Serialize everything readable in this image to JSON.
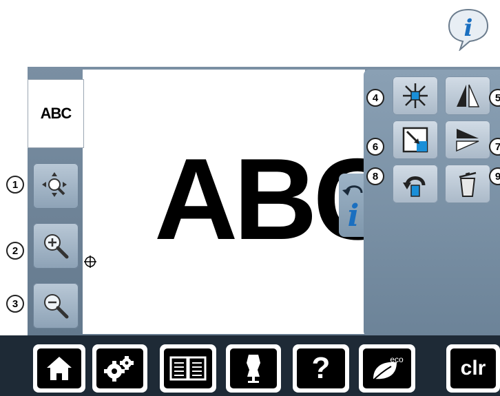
{
  "thumbnail": {
    "text": "ABC"
  },
  "canvas": {
    "text": "ABC"
  },
  "callouts": [
    "1",
    "2",
    "3",
    "4",
    "5",
    "6",
    "7",
    "8",
    "9"
  ],
  "left_buttons": [
    {
      "icon": "move-magnifier-icon"
    },
    {
      "icon": "zoom-in-icon"
    },
    {
      "icon": "zoom-out-icon"
    }
  ],
  "right_buttons": [
    {
      "icon": "center-icon"
    },
    {
      "icon": "mirror-vertical-icon"
    },
    {
      "icon": "resize-icon"
    },
    {
      "icon": "mirror-horizontal-icon"
    },
    {
      "icon": "rotate-icon"
    },
    {
      "icon": "delete-icon"
    }
  ],
  "taskbar": {
    "help_label": "?",
    "eco_label": "eco",
    "clr_label": "clr"
  },
  "colors": {
    "accent": "#1a8fd8",
    "panel": "#6f859a"
  }
}
